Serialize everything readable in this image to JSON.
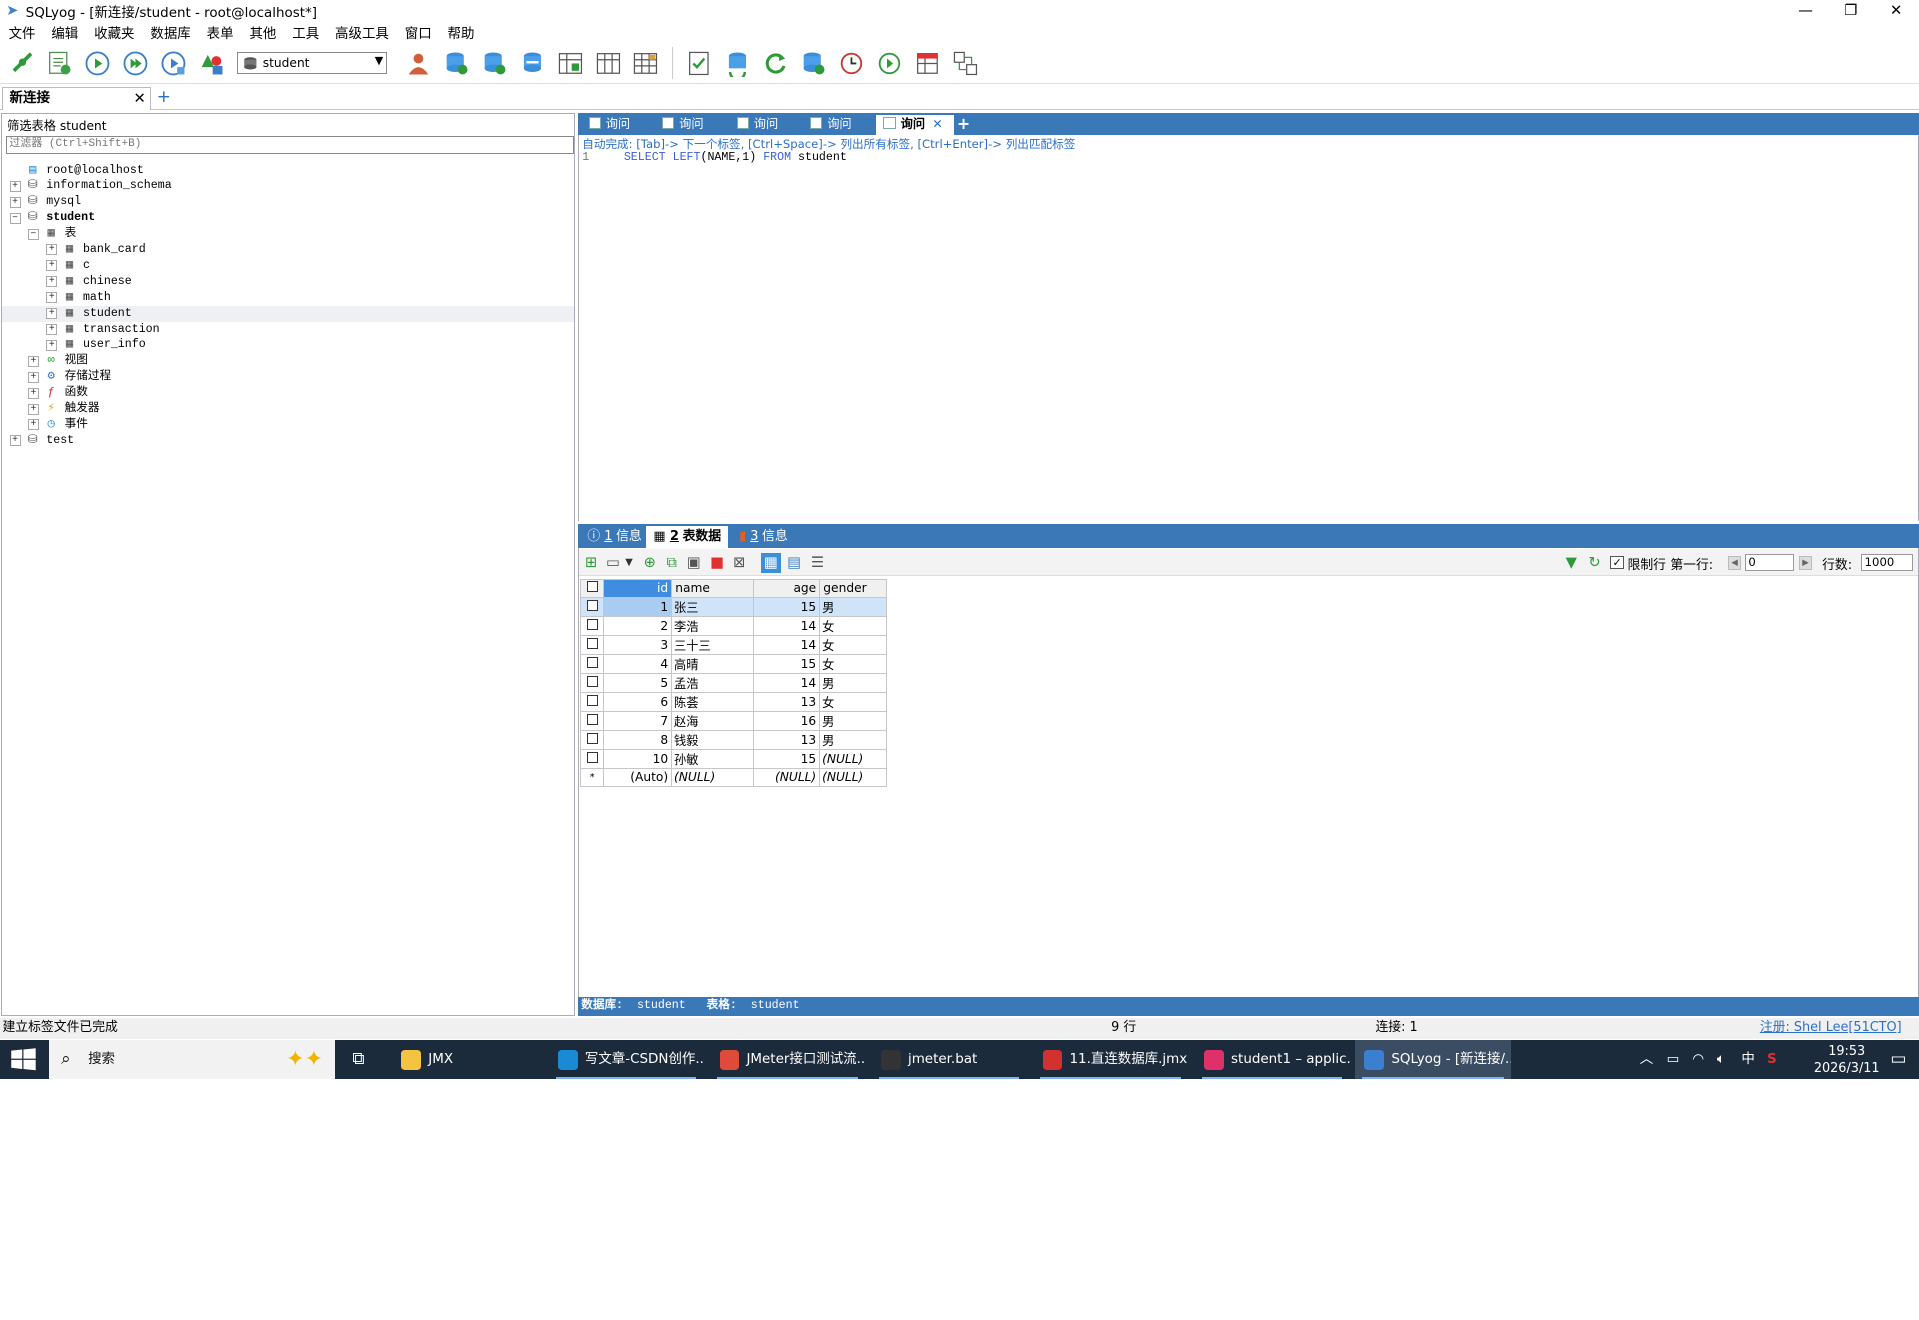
{
  "window": {
    "title": "SQLyog - [新连接/student - root@localhost*]",
    "minimize": "—",
    "maximize": "❐",
    "close": "✕"
  },
  "menu": [
    "文件",
    "编辑",
    "收藏夹",
    "数据库",
    "表单",
    "其他",
    "工具",
    "高级工具",
    "窗口",
    "帮助"
  ],
  "toolbar": {
    "db_select": "student",
    "icons": [
      "new-connection-icon",
      "new-query-icon",
      "execute-icon",
      "execute-all-icon",
      "execute-edit-icon",
      "schema-designer-icon",
      "user-manager-icon",
      "create-db-icon",
      "alter-db-icon",
      "backup-icon",
      "restore-icon",
      "import-icon",
      "export-icon",
      "query-builder-icon",
      "data-sync-icon",
      "refresh-icon",
      "schema-sync-icon",
      "scheduler-icon",
      "history-icon",
      "table-diagnostics-icon",
      "database-diff-icon"
    ]
  },
  "connection_tab": {
    "label": "新连接",
    "close": "✕",
    "add": "+"
  },
  "left": {
    "filter_label": "筛选表格 student",
    "filter_placeholder": "过滤器 (Ctrl+Shift+B)",
    "tree": [
      {
        "label": "root@localhost",
        "level": 0,
        "icon": "server",
        "exp": ""
      },
      {
        "label": "information_schema",
        "level": 0,
        "icon": "db",
        "exp": "+"
      },
      {
        "label": "mysql",
        "level": 0,
        "icon": "db",
        "exp": "+"
      },
      {
        "label": "student",
        "level": 0,
        "icon": "db",
        "exp": "−",
        "bold": true
      },
      {
        "label": "表",
        "level": 1,
        "icon": "folder",
        "exp": "−"
      },
      {
        "label": "bank_card",
        "level": 2,
        "icon": "table",
        "exp": "+"
      },
      {
        "label": "c",
        "level": 2,
        "icon": "table",
        "exp": "+"
      },
      {
        "label": "chinese",
        "level": 2,
        "icon": "table",
        "exp": "+"
      },
      {
        "label": "math",
        "level": 2,
        "icon": "table",
        "exp": "+"
      },
      {
        "label": "student",
        "level": 2,
        "icon": "table",
        "exp": "+",
        "selected": true
      },
      {
        "label": "transaction",
        "level": 2,
        "icon": "table",
        "exp": "+"
      },
      {
        "label": "user_info",
        "level": 2,
        "icon": "table",
        "exp": "+"
      },
      {
        "label": "视图",
        "level": 1,
        "icon": "view",
        "exp": "+"
      },
      {
        "label": "存储过程",
        "level": 1,
        "icon": "proc",
        "exp": "+"
      },
      {
        "label": "函数",
        "level": 1,
        "icon": "func",
        "exp": "+"
      },
      {
        "label": "触发器",
        "level": 1,
        "icon": "trigger",
        "exp": "+"
      },
      {
        "label": "事件",
        "level": 1,
        "icon": "event",
        "exp": "+"
      },
      {
        "label": "test",
        "level": 0,
        "icon": "db",
        "exp": "+"
      }
    ]
  },
  "query_tabs": [
    {
      "label": "询问",
      "active": false
    },
    {
      "label": "询问",
      "active": false
    },
    {
      "label": "询问",
      "active": false
    },
    {
      "label": "询问",
      "active": false
    },
    {
      "label": "询问",
      "active": true
    }
  ],
  "query_tab_add": "+",
  "query_tab_close": "✕",
  "editor": {
    "hint": "自动完成: [Tab]-> 下一个标签, [Ctrl+Space]-> 列出所有标签, [Ctrl+Enter]-> 列出匹配标签",
    "line_no": "1",
    "kw1": "SELECT",
    "kw2": "LEFT",
    "args": "(NAME,1)",
    "kw3": "FROM",
    "table": "student"
  },
  "result_tabs": [
    {
      "num": "1",
      "label": "信息",
      "active": false,
      "icon": "info"
    },
    {
      "num": "2",
      "label": "表数据",
      "active": true,
      "icon": "grid"
    },
    {
      "num": "3",
      "label": "信息",
      "active": false,
      "icon": "chart"
    }
  ],
  "result_toolbar": {
    "limit_label": "限制行",
    "limit_checked": "✓",
    "first_row_label": "第一行:",
    "first_row_value": "0",
    "rows_label": "行数:",
    "rows_value": "1000"
  },
  "grid": {
    "columns": [
      "id",
      "name",
      "age",
      "gender"
    ],
    "rows": [
      [
        "1",
        "张三",
        "15",
        "男"
      ],
      [
        "2",
        "李浩",
        "14",
        "女"
      ],
      [
        "3",
        "三十三",
        "14",
        "女"
      ],
      [
        "4",
        "高晴",
        "15",
        "女"
      ],
      [
        "5",
        "孟浩",
        "14",
        "男"
      ],
      [
        "6",
        "陈荟",
        "13",
        "女"
      ],
      [
        "7",
        "赵海",
        "16",
        "男"
      ],
      [
        "8",
        "钱毅",
        "13",
        "男"
      ],
      [
        "10",
        "孙敏",
        "15",
        "(NULL)"
      ]
    ],
    "new_row": [
      "*",
      "(Auto)",
      "(NULL)",
      "(NULL)",
      "(NULL)"
    ]
  },
  "infobar": {
    "db_label": "数据库:",
    "db": "student",
    "table_label": "表格:",
    "table": "student"
  },
  "status": {
    "message": "建立标签文件已完成",
    "rows": "9 行",
    "connections": "连接: 1",
    "register": "注册: Shel Lee[51CTO]"
  },
  "taskbar": {
    "search": "搜索",
    "tasks": [
      {
        "label": "JMX",
        "color": "#f5c342",
        "open": false
      },
      {
        "label": "写文章-CSDN创作...",
        "color": "#1a8ad4",
        "open": true
      },
      {
        "label": "JMeter接口测试流...",
        "color": "#e04a3a",
        "open": true
      },
      {
        "label": "jmeter.bat",
        "color": "#333333",
        "open": true
      },
      {
        "label": "11.直连数据库.jmx...",
        "color": "#d33030",
        "open": true
      },
      {
        "label": "student1 – applic...",
        "color": "#e0306a",
        "open": true
      },
      {
        "label": "SQLyog - [新连接/...",
        "color": "#3b7fd0",
        "open": true,
        "active": true
      }
    ],
    "ime": "中",
    "time": "19:53",
    "date": "2026/3/11"
  }
}
